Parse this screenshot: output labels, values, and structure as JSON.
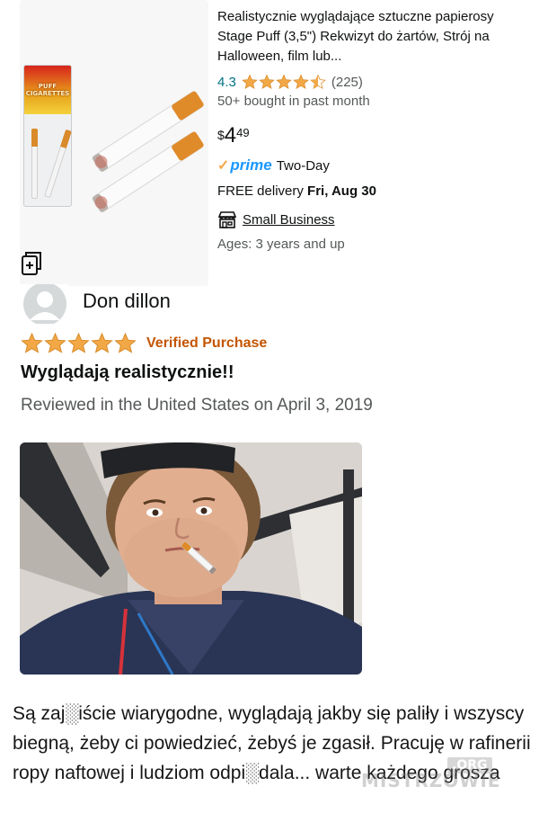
{
  "product": {
    "title": "Realistycznie wyglądające sztuczne papierosy Stage Puff (3,5\") Rekwizyt do żartów, Strój na Halloween, film lub...",
    "pack_brand": "PUFF CIGARETTES",
    "rating_value": "4.3",
    "rating_stars": 4.3,
    "rating_count": "(225)",
    "bought_text": "50+ bought in past month",
    "price": {
      "symbol": "$",
      "whole": "4",
      "fraction": "49"
    },
    "prime_label": "prime",
    "prime_service": "Two-Day",
    "delivery_prefix": "FREE delivery ",
    "delivery_date": "Fri, Aug 30",
    "small_business_label": "Small Business",
    "ages_text": "Ages: 3 years and up"
  },
  "review": {
    "reviewer_name": "Don dillon",
    "stars": 5,
    "verified_label": "Verified Purchase",
    "title": "Wyglądają realistycznie!!",
    "meta": "Reviewed in the United States on April 3, 2019",
    "body": "Są zaj░iście wiarygodne, wyglądają jakby się paliły i wszyscy biegną, żeby ci powiedzieć, żebyś je zgasił. Pracuję w rafinerii ropy naftowej i ludziom odpi░dala... warte każdego grosza"
  },
  "watermark": {
    "main": "MISTRZOWIE",
    "tld": ".ORG"
  },
  "colors": {
    "link": "#007185",
    "star": "#f3a847",
    "verified": "#c45500",
    "prime_blue": "#1a98ff",
    "secondary_text": "#565959"
  },
  "icons": [
    "copy-icon",
    "star-icon",
    "half-star-icon",
    "prime-check-icon",
    "store-icon",
    "avatar-icon"
  ]
}
